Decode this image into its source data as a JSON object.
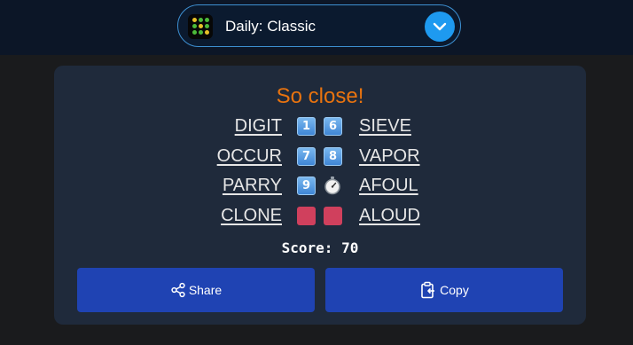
{
  "header": {
    "mode_label": "Daily: Classic",
    "logo_icon": "traffic-light-grid-icon",
    "dropdown_icon": "chevron-down-icon"
  },
  "result": {
    "headline": "So close!",
    "rows": [
      {
        "left_word": "DIGIT",
        "right_word": "SIEVE",
        "markers": [
          "1",
          "6"
        ]
      },
      {
        "left_word": "OCCUR",
        "right_word": "VAPOR",
        "markers": [
          "7",
          "8"
        ]
      },
      {
        "left_word": "PARRY",
        "right_word": "AFOUL",
        "markers": [
          "9",
          "stopwatch-icon"
        ]
      },
      {
        "left_word": "CLONE",
        "right_word": "ALOUD",
        "markers": [
          "red-square",
          "red-square"
        ]
      }
    ],
    "score_text": "Score: 70"
  },
  "actions": {
    "share_label": "Share",
    "share_icon": "share-icon",
    "copy_label": "Copy",
    "copy_icon": "clipboard-copy-icon"
  },
  "colors": {
    "headline": "#e8730f",
    "button": "#1f43b3",
    "dropdown": "#1e9af0",
    "miss_tile": "#d0405d"
  }
}
